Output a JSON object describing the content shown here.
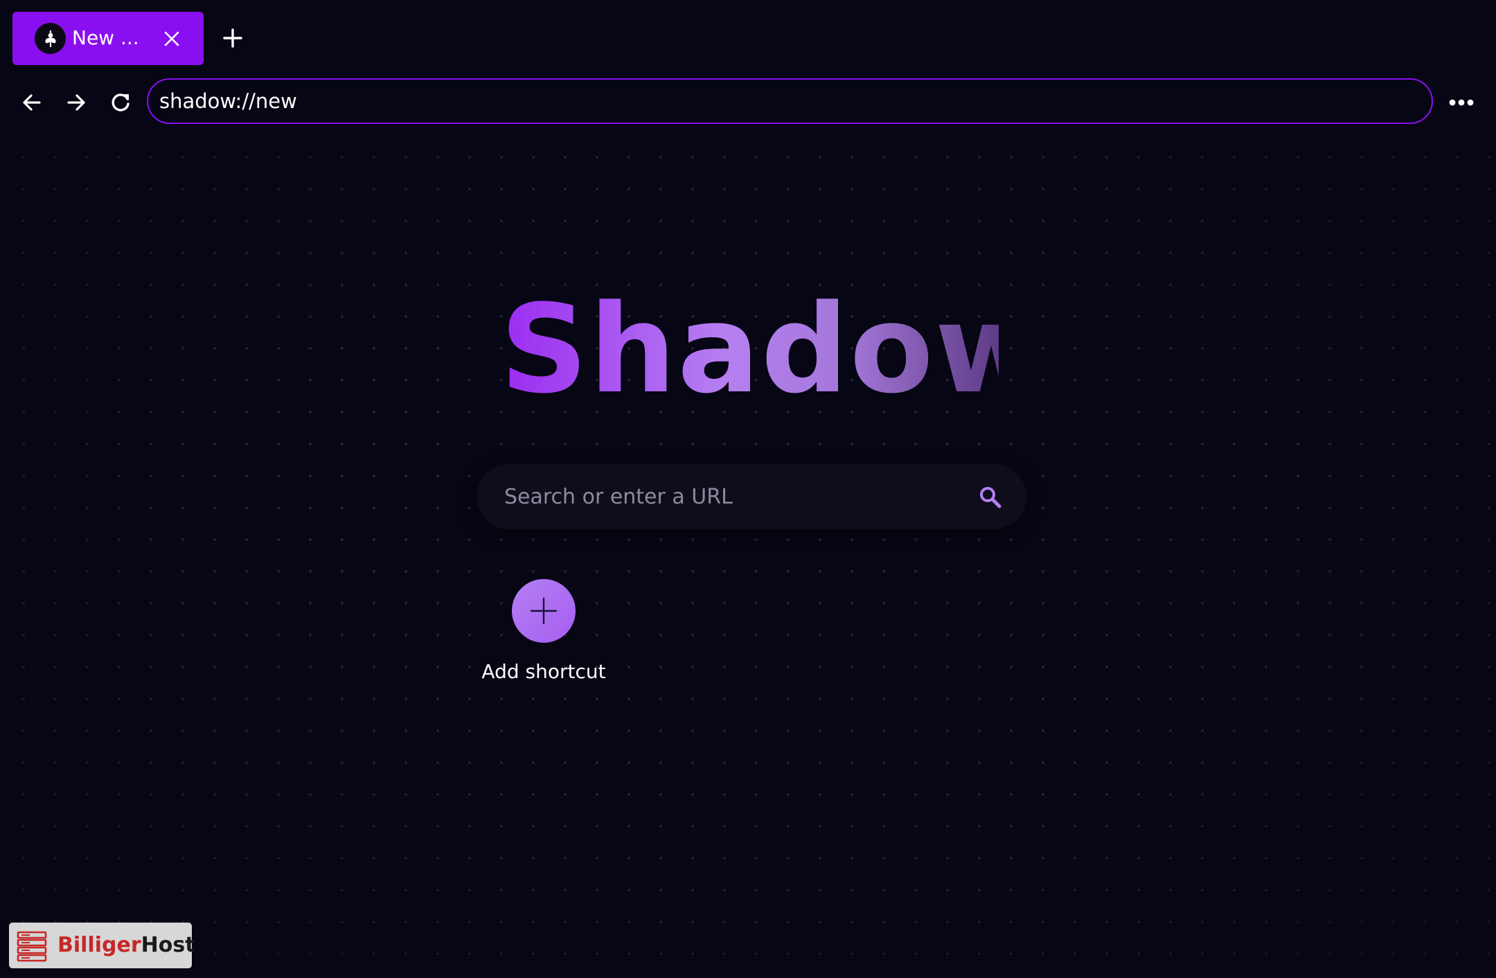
{
  "tabs": [
    {
      "title": "New ...",
      "favicon": "shadow-logo-icon",
      "active": true
    }
  ],
  "toolbar": {
    "address_value": "shadow://new"
  },
  "home": {
    "logo_title": "Shadow",
    "search_placeholder": "Search or enter a URL",
    "add_shortcut_label": "Add shortcut"
  },
  "badge": {
    "brand_part1": "Billiger",
    "brand_part2": "Host"
  },
  "colors": {
    "accent": "#8a0ff0",
    "background": "#070614",
    "shortcut_circle": "#b57ff4",
    "search_icon": "#b57ff4"
  },
  "icons": {
    "tab_close": "close-icon",
    "new_tab": "plus-icon",
    "back": "arrow-left-icon",
    "forward": "arrow-right-icon",
    "reload": "reload-icon",
    "menu": "more-horizontal-icon",
    "search": "search-icon",
    "add_shortcut": "plus-icon"
  }
}
